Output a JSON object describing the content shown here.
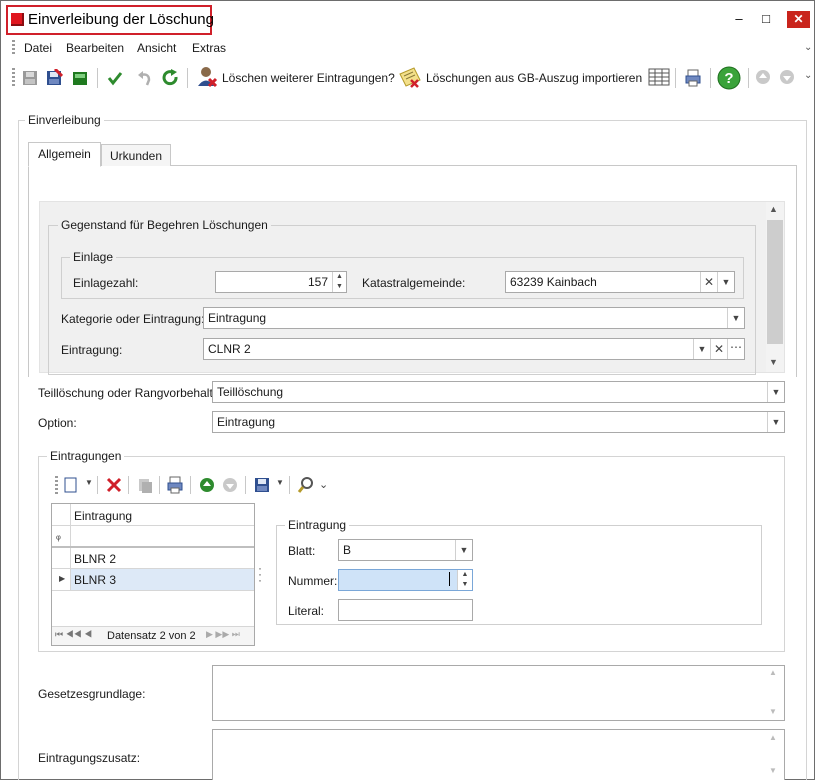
{
  "window": {
    "title": "Einverleibung der Löschung",
    "minimize_glyph": "–",
    "maximize_glyph": "□",
    "close_glyph": "✕"
  },
  "menu": {
    "items": [
      "Datei",
      "Bearbeiten",
      "Ansicht",
      "Extras"
    ]
  },
  "toolbar": {
    "delete_further_label": "Löschen weiterer Eintragungen?",
    "import_label": "Löschungen aus GB-Auszug importieren",
    "icons": [
      "save-icon",
      "save-close-icon",
      "green-square-icon",
      "checkmark-icon",
      "undo-icon",
      "refresh-icon",
      "user-delete-icon",
      "import-icon",
      "table-icon",
      "print-icon",
      "help-icon",
      "arrow-up-icon",
      "arrow-down-icon"
    ]
  },
  "main": {
    "group_label": "Einverleibung",
    "tabs": [
      "Allgemein",
      "Urkunden"
    ],
    "active_tab": "Allgemein",
    "gegenstand": {
      "group_label": "Gegenstand für Begehren Löschungen",
      "einlage": {
        "group_label": "Einlage",
        "einlagezahl_label": "Einlagezahl:",
        "einlagezahl_value": "157",
        "katastralgemeinde_label": "Katastralgemeinde:",
        "katastralgemeinde_value": "63239 Kainbach"
      },
      "kategorie_label": "Kategorie oder Eintragung:",
      "kategorie_value": "Eintragung",
      "eintragung_label": "Eintragung:",
      "eintragung_value": "CLNR 2"
    },
    "teilloeschung_label": "Teillöschung oder Rangvorbehalt:",
    "teilloeschung_value": "Teillöschung",
    "option_label": "Option:",
    "option_value": "Eintragung",
    "eintragungen": {
      "group_label": "Eintragungen",
      "grid": {
        "column_header": "Eintragung",
        "filter_glyph": "ᵩ",
        "rows": [
          "BLNR 2",
          "BLNR 3"
        ],
        "selected_row": 1,
        "nav_text": "Datensatz 2 von 2"
      },
      "detail": {
        "group_label": "Eintragung",
        "blatt_label": "Blatt:",
        "blatt_value": "B",
        "nummer_label": "Nummer:",
        "nummer_value": "",
        "literal_label": "Literal:",
        "literal_value": ""
      }
    },
    "gesetzesgrundlage_label": "Gesetzesgrundlage:",
    "gesetzesgrundlage_value": "",
    "eintragungszusatz_label": "Eintragungszusatz:",
    "eintragungszusatz_value": ""
  },
  "colors": {
    "title_highlight": "#d0202a",
    "app_icon": "#e0161e",
    "selected_row": "#dde9f7",
    "nummer_field_bg": "#cfe3f8",
    "green_icon": "#2e8b2e"
  }
}
